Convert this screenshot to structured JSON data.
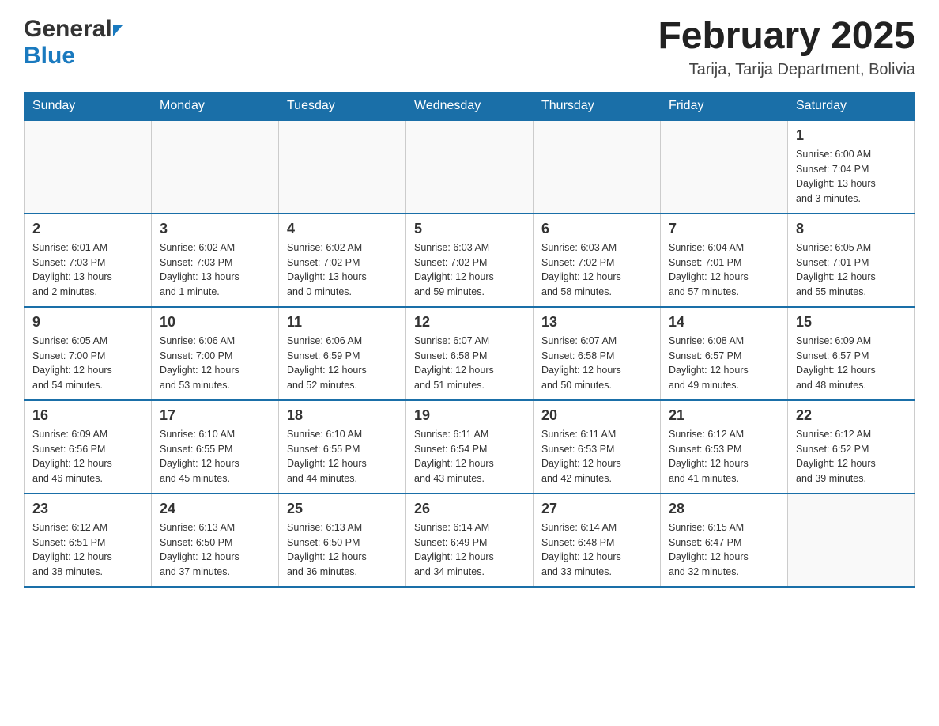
{
  "header": {
    "logo_line1": "General",
    "logo_line2": "Blue",
    "month_title": "February 2025",
    "location": "Tarija, Tarija Department, Bolivia"
  },
  "weekdays": [
    "Sunday",
    "Monday",
    "Tuesday",
    "Wednesday",
    "Thursday",
    "Friday",
    "Saturday"
  ],
  "weeks": [
    [
      {
        "day": "",
        "info": ""
      },
      {
        "day": "",
        "info": ""
      },
      {
        "day": "",
        "info": ""
      },
      {
        "day": "",
        "info": ""
      },
      {
        "day": "",
        "info": ""
      },
      {
        "day": "",
        "info": ""
      },
      {
        "day": "1",
        "info": "Sunrise: 6:00 AM\nSunset: 7:04 PM\nDaylight: 13 hours\nand 3 minutes."
      }
    ],
    [
      {
        "day": "2",
        "info": "Sunrise: 6:01 AM\nSunset: 7:03 PM\nDaylight: 13 hours\nand 2 minutes."
      },
      {
        "day": "3",
        "info": "Sunrise: 6:02 AM\nSunset: 7:03 PM\nDaylight: 13 hours\nand 1 minute."
      },
      {
        "day": "4",
        "info": "Sunrise: 6:02 AM\nSunset: 7:02 PM\nDaylight: 13 hours\nand 0 minutes."
      },
      {
        "day": "5",
        "info": "Sunrise: 6:03 AM\nSunset: 7:02 PM\nDaylight: 12 hours\nand 59 minutes."
      },
      {
        "day": "6",
        "info": "Sunrise: 6:03 AM\nSunset: 7:02 PM\nDaylight: 12 hours\nand 58 minutes."
      },
      {
        "day": "7",
        "info": "Sunrise: 6:04 AM\nSunset: 7:01 PM\nDaylight: 12 hours\nand 57 minutes."
      },
      {
        "day": "8",
        "info": "Sunrise: 6:05 AM\nSunset: 7:01 PM\nDaylight: 12 hours\nand 55 minutes."
      }
    ],
    [
      {
        "day": "9",
        "info": "Sunrise: 6:05 AM\nSunset: 7:00 PM\nDaylight: 12 hours\nand 54 minutes."
      },
      {
        "day": "10",
        "info": "Sunrise: 6:06 AM\nSunset: 7:00 PM\nDaylight: 12 hours\nand 53 minutes."
      },
      {
        "day": "11",
        "info": "Sunrise: 6:06 AM\nSunset: 6:59 PM\nDaylight: 12 hours\nand 52 minutes."
      },
      {
        "day": "12",
        "info": "Sunrise: 6:07 AM\nSunset: 6:58 PM\nDaylight: 12 hours\nand 51 minutes."
      },
      {
        "day": "13",
        "info": "Sunrise: 6:07 AM\nSunset: 6:58 PM\nDaylight: 12 hours\nand 50 minutes."
      },
      {
        "day": "14",
        "info": "Sunrise: 6:08 AM\nSunset: 6:57 PM\nDaylight: 12 hours\nand 49 minutes."
      },
      {
        "day": "15",
        "info": "Sunrise: 6:09 AM\nSunset: 6:57 PM\nDaylight: 12 hours\nand 48 minutes."
      }
    ],
    [
      {
        "day": "16",
        "info": "Sunrise: 6:09 AM\nSunset: 6:56 PM\nDaylight: 12 hours\nand 46 minutes."
      },
      {
        "day": "17",
        "info": "Sunrise: 6:10 AM\nSunset: 6:55 PM\nDaylight: 12 hours\nand 45 minutes."
      },
      {
        "day": "18",
        "info": "Sunrise: 6:10 AM\nSunset: 6:55 PM\nDaylight: 12 hours\nand 44 minutes."
      },
      {
        "day": "19",
        "info": "Sunrise: 6:11 AM\nSunset: 6:54 PM\nDaylight: 12 hours\nand 43 minutes."
      },
      {
        "day": "20",
        "info": "Sunrise: 6:11 AM\nSunset: 6:53 PM\nDaylight: 12 hours\nand 42 minutes."
      },
      {
        "day": "21",
        "info": "Sunrise: 6:12 AM\nSunset: 6:53 PM\nDaylight: 12 hours\nand 41 minutes."
      },
      {
        "day": "22",
        "info": "Sunrise: 6:12 AM\nSunset: 6:52 PM\nDaylight: 12 hours\nand 39 minutes."
      }
    ],
    [
      {
        "day": "23",
        "info": "Sunrise: 6:12 AM\nSunset: 6:51 PM\nDaylight: 12 hours\nand 38 minutes."
      },
      {
        "day": "24",
        "info": "Sunrise: 6:13 AM\nSunset: 6:50 PM\nDaylight: 12 hours\nand 37 minutes."
      },
      {
        "day": "25",
        "info": "Sunrise: 6:13 AM\nSunset: 6:50 PM\nDaylight: 12 hours\nand 36 minutes."
      },
      {
        "day": "26",
        "info": "Sunrise: 6:14 AM\nSunset: 6:49 PM\nDaylight: 12 hours\nand 34 minutes."
      },
      {
        "day": "27",
        "info": "Sunrise: 6:14 AM\nSunset: 6:48 PM\nDaylight: 12 hours\nand 33 minutes."
      },
      {
        "day": "28",
        "info": "Sunrise: 6:15 AM\nSunset: 6:47 PM\nDaylight: 12 hours\nand 32 minutes."
      },
      {
        "day": "",
        "info": ""
      }
    ]
  ]
}
